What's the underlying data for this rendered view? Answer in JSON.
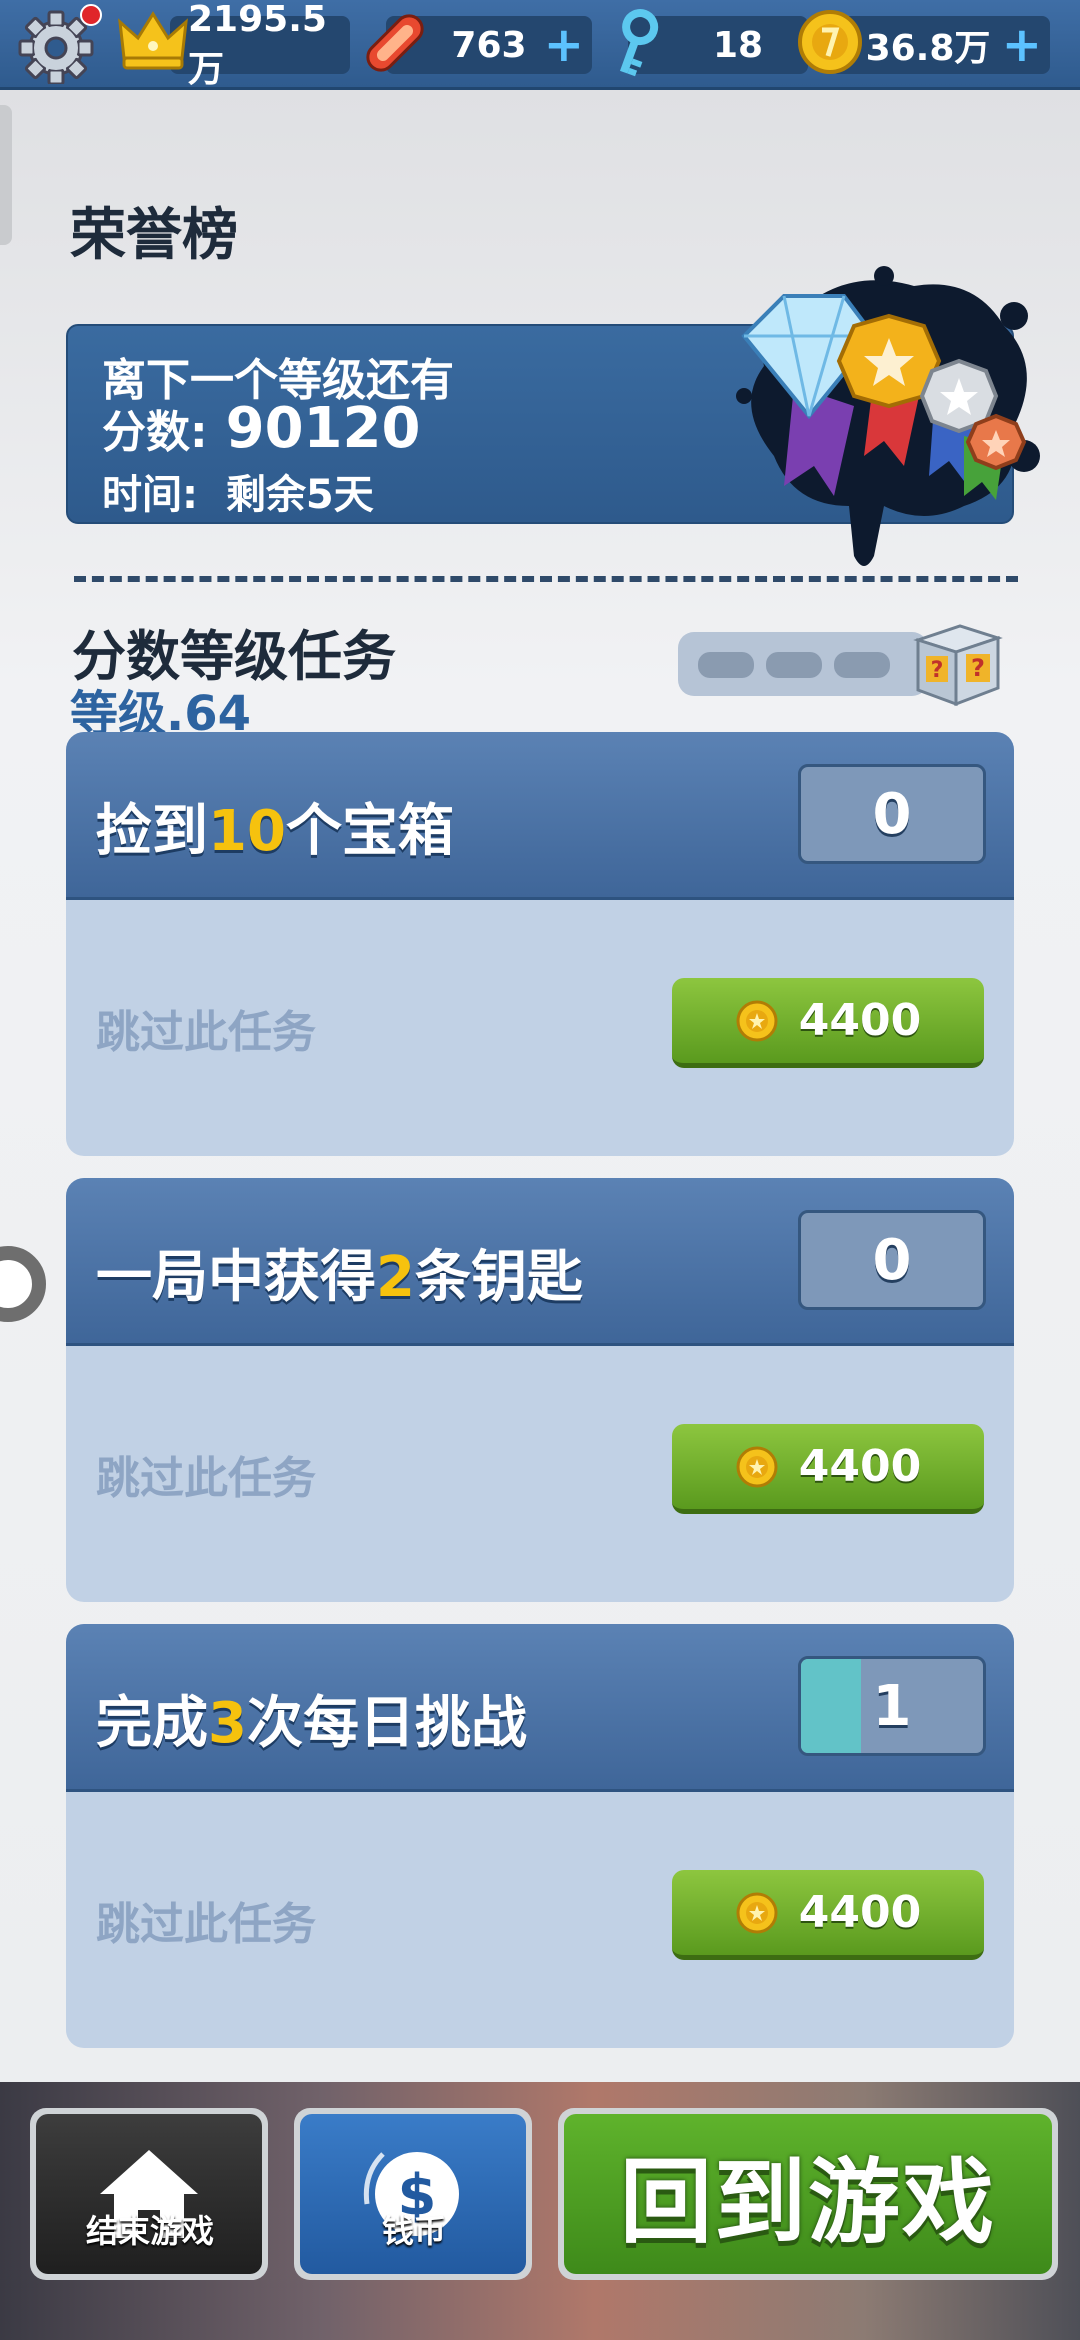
{
  "topbar": {
    "trophy_value": "2195.5万",
    "boards_value": "763",
    "keys_value": "18",
    "coins_value": "36.8万",
    "plus_symbol": "+"
  },
  "header": {
    "title": "荣誉榜",
    "next_level_label": "离下一个等级还有",
    "score_label": "分数:",
    "score_value": "90120",
    "time_label": "时间:",
    "time_value": "剩余5天"
  },
  "section": {
    "title": "分数等级任务",
    "level": "等级.64",
    "progress_filled": 0,
    "progress_total": 3
  },
  "tasks": [
    {
      "pre": "捡到",
      "num": "10",
      "post": "个宝箱",
      "count": "0",
      "progress": 0,
      "skip_label": "跳过此任务",
      "cost": "4400"
    },
    {
      "pre": "一局中获得",
      "num": "2",
      "post": "条钥匙",
      "count": "0",
      "progress": 0,
      "skip_label": "跳过此任务",
      "cost": "4400"
    },
    {
      "pre": "完成",
      "num": "3",
      "post": "次每日挑战",
      "count": "1",
      "progress": 0.33,
      "skip_label": "跳过此任务",
      "cost": "4400"
    }
  ],
  "bottom": {
    "end_game_label": "结束游戏",
    "coins_label": "钱币",
    "back_to_game_label": "回到游戏"
  },
  "icons": {
    "settings": "gear-icon",
    "trophy": "crown-icon",
    "boards": "hoverboard-icon",
    "keys": "key-icon",
    "coins": "coin-icon",
    "home": "home-icon",
    "dollar": "dollar-icon",
    "medals": "medals-icon",
    "mystery_box": "mystery-box-icon"
  },
  "colors": {
    "highlight": "#f6c20e",
    "skip_button": "#6aaa2a",
    "play_button": "#4f9c25",
    "header_blue": "#3a6ba0"
  }
}
